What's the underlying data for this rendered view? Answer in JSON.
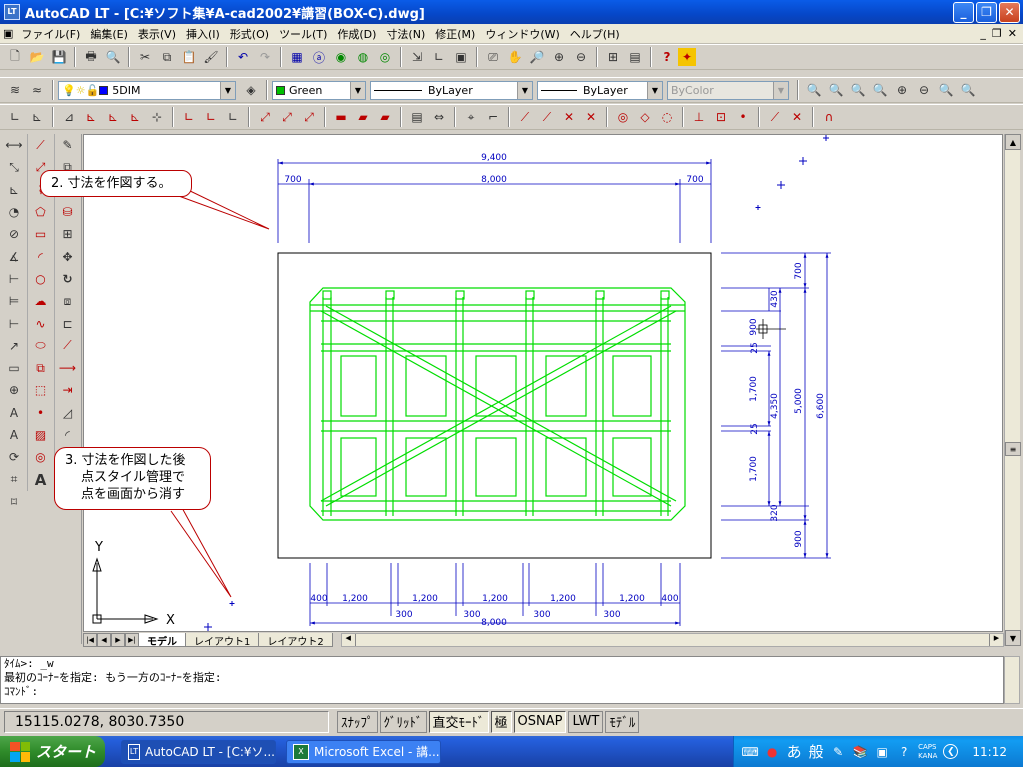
{
  "window": {
    "title": "AutoCAD LT - [C:¥ソフト集¥A-cad2002¥講習(BOX-C).dwg]",
    "app_icon": "autocad-lt-icon"
  },
  "menu": [
    "ファイル(F)",
    "編集(E)",
    "表示(V)",
    "挿入(I)",
    "形式(O)",
    "ツール(T)",
    "作成(D)",
    "寸法(N)",
    "修正(M)",
    "ウィンドウ(W)",
    "ヘルプ(H)"
  ],
  "layers": {
    "current": "5DIM",
    "color": "Green",
    "color_hex": "#00c000",
    "linetype": "ByLayer",
    "lineweight": "ByLayer",
    "plotstyle": "ByColor"
  },
  "callouts": {
    "c2": "2. 寸法を作図する。",
    "c3": [
      "3. 寸法を作図した後",
      "点スタイル管理で",
      "点を画面から消す"
    ]
  },
  "dims": {
    "top_total": "9,400",
    "top_inner": "8,000",
    "top_left": "700",
    "top_right": "700",
    "right_700": "700",
    "right_430": "430",
    "right_900": "900",
    "right_25a": "25",
    "right_1700a": "1,700",
    "right_4350": "4,350",
    "right_5000": "5,000",
    "right_6600": "6,600",
    "right_25b": "25",
    "right_1700b": "1,700",
    "right_320": "320",
    "right_900b": "900",
    "bottom_total": "8,000",
    "bottom_400l": "400",
    "bottom_400r": "400",
    "bottom_1200": "1,200",
    "bottom_300": "300"
  },
  "ucs": {
    "x": "X",
    "y": "Y"
  },
  "tabs": [
    "モデル",
    "レイアウト1",
    "レイアウト2"
  ],
  "command_lines": [
    "ﾀｲﾑ>:  _w",
    "最初のｺｰﾅｰを指定: もう一方のｺｰﾅｰを指定:",
    "ｺﾏﾝﾄﾞ:"
  ],
  "status": {
    "coords": "15115.0278, 8030.7350",
    "buttons": [
      "ｽﾅｯﾌﾟ",
      "ｸﾞﾘｯﾄﾞ",
      "直交ﾓｰﾄﾞ",
      "極",
      "OSNAP",
      "LWT",
      "ﾓﾃﾞﾙ"
    ]
  },
  "taskbar": {
    "start": "スタート",
    "tasks": [
      "AutoCAD LT - [C:¥ソ...",
      "Microsoft Excel - 講..."
    ],
    "ime": [
      "あ",
      "般"
    ],
    "caps": "CAPS",
    "kana": "KANA",
    "clock": "11:12"
  }
}
